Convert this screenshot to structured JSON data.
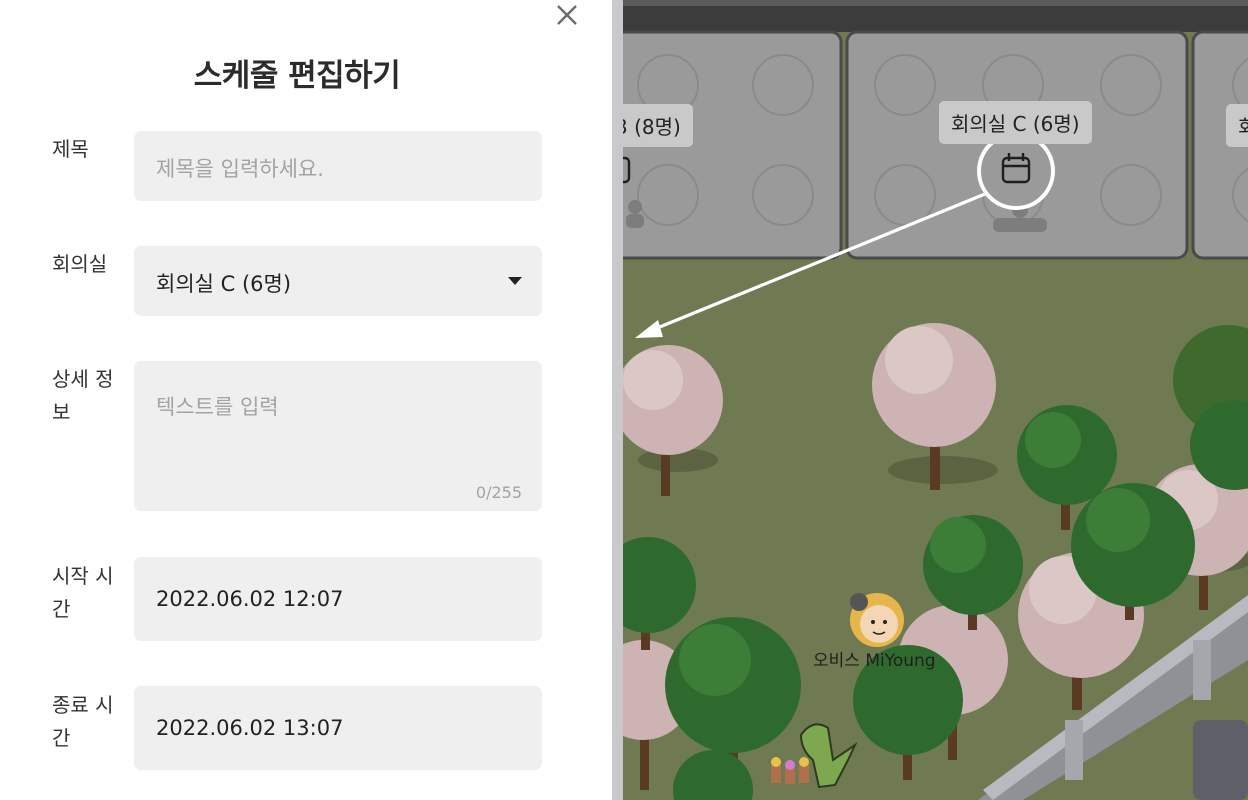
{
  "dialog": {
    "title": "스케줄 편집하기",
    "fields": {
      "subject": {
        "label": "제목",
        "placeholder": "제목을 입력하세요."
      },
      "room": {
        "label": "회의실",
        "value": "회의실 C (6명)"
      },
      "details": {
        "label": "상세 정보",
        "placeholder": "텍스트를 입력",
        "counter": "0/255"
      },
      "start": {
        "label": "시작 시간",
        "value": "2022.06.02 12:07"
      },
      "end": {
        "label": "종료 시간",
        "value": "2022.06.02 13:07"
      }
    }
  },
  "map": {
    "rooms": [
      {
        "label": "3 (8명)"
      },
      {
        "label": "회의실 C (6명)"
      },
      {
        "label": "회"
      }
    ],
    "avatar": {
      "name": "오비스 MiYoung"
    },
    "colors": {
      "grass": "#6f7a52",
      "room": "#9a9a9a",
      "blossom": "#d9c4c4",
      "tree": "#2e6a2e"
    }
  }
}
